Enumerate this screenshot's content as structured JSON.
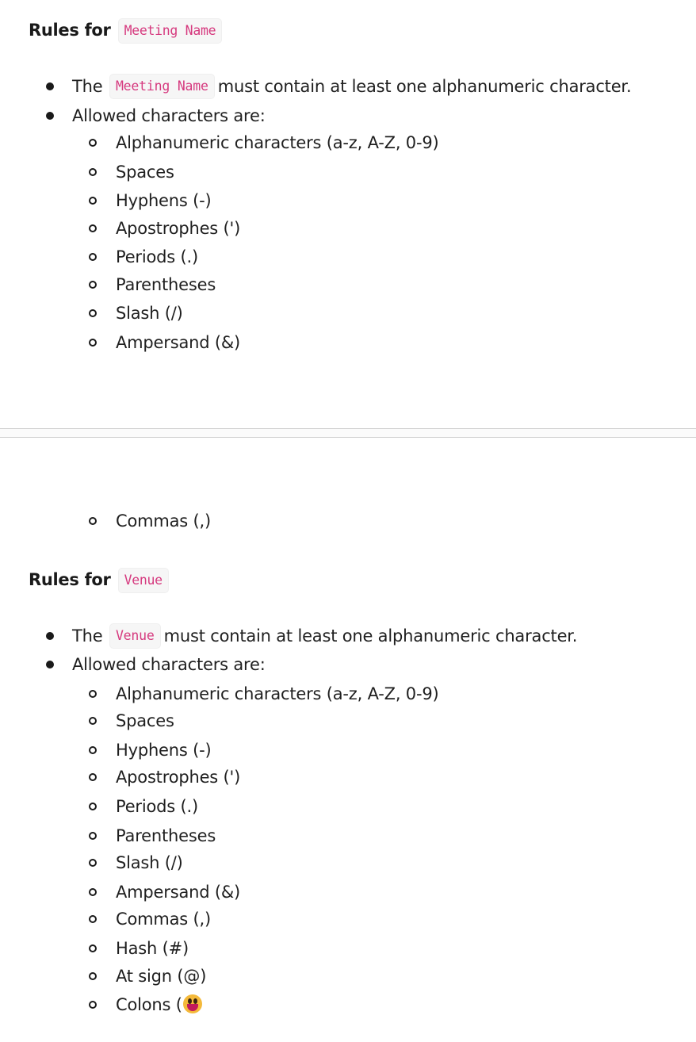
{
  "section1": {
    "heading_prefix": "Rules for",
    "heading_code": "Meeting Name",
    "rule1_before": "The",
    "rule1_code": "Meeting Name",
    "rule1_after": "must contain at least one alphanumeric character.",
    "rule2": "Allowed characters are:",
    "allowed": [
      "Alphanumeric characters (a-z, A-Z, 0-9)",
      "Spaces",
      "Hyphens (-)",
      "Apostrophes (')",
      "Periods (.)",
      "Parentheses",
      "Slash (/)",
      "Ampersand (&)"
    ]
  },
  "continued": {
    "item": "Commas (,)"
  },
  "section2": {
    "heading_prefix": "Rules for",
    "heading_code": "Venue",
    "rule1_before": "The",
    "rule1_code": "Venue",
    "rule1_after": "must contain at least one alphanumeric character.",
    "rule2": "Allowed characters are:",
    "allowed": [
      "Alphanumeric characters (a-z, A-Z, 0-9)",
      "Spaces",
      "Hyphens (-)",
      "Apostrophes (')",
      "Periods (.)",
      "Parentheses",
      "Slash (/)",
      "Ampersand (&)",
      "Commas (,)",
      "Hash (#)",
      "At sign (@)",
      "Colons ("
    ],
    "last_item_emoji": "grinning-face-emoji"
  },
  "colors": {
    "code_text": "#d63a7f",
    "code_background": "#f6f6f6",
    "text": "#1f1f1f",
    "divider": "#cfcfcf"
  }
}
